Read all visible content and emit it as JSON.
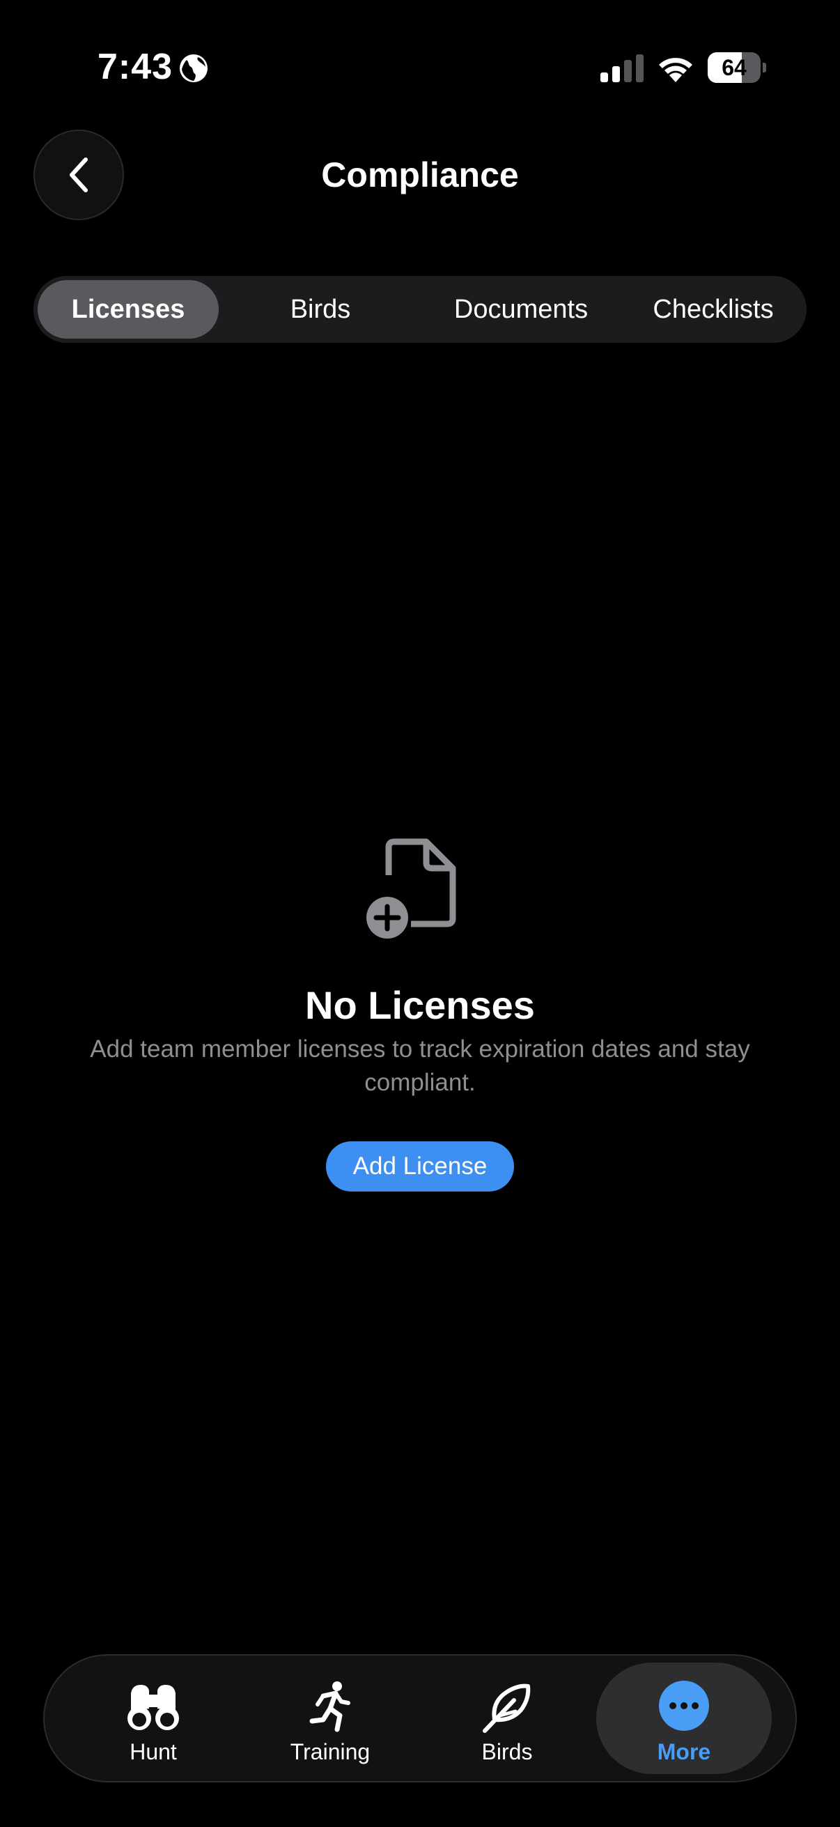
{
  "status_bar": {
    "time": "7:43",
    "battery_level": "64",
    "battery_fraction": 0.64
  },
  "header": {
    "title": "Compliance",
    "back_icon": "chevron-left-icon"
  },
  "tabs": [
    {
      "label": "Licenses",
      "active": true
    },
    {
      "label": "Birds",
      "active": false
    },
    {
      "label": "Documents",
      "active": false
    },
    {
      "label": "Checklists",
      "active": false
    }
  ],
  "empty_state": {
    "icon": "document-add-icon",
    "title": "No Licenses",
    "description": "Add team member licenses to track expiration dates and stay compliant.",
    "button_label": "Add License"
  },
  "tab_bar": {
    "items": [
      {
        "label": "Hunt",
        "icon": "binoculars-icon",
        "active": false
      },
      {
        "label": "Training",
        "icon": "running-person-icon",
        "active": false
      },
      {
        "label": "Birds",
        "icon": "feather-icon",
        "active": false
      },
      {
        "label": "More",
        "icon": "more-icon",
        "active": true
      }
    ]
  },
  "colors": {
    "background": "#000000",
    "accent": "#3d8ff2",
    "secondary_text": "#8e8e93",
    "active_tab_label": "#4a9df5"
  }
}
